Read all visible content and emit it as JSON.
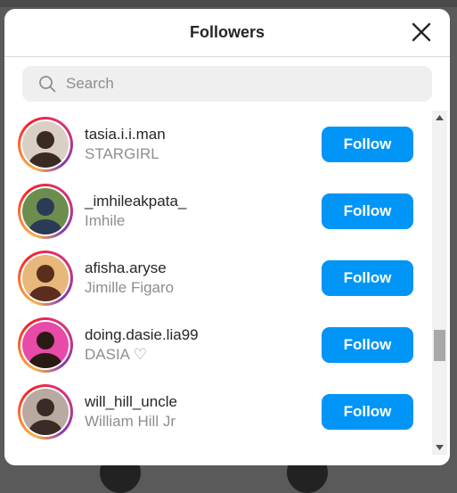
{
  "modal": {
    "title": "Followers",
    "close_icon": "close-icon"
  },
  "search": {
    "placeholder": "Search",
    "icon": "search-icon"
  },
  "followers": [
    {
      "username": "tasia.i.i.man",
      "fullname": "STARGIRL",
      "button": "Follow",
      "avatar_colors": [
        "#3a2a22",
        "#d9cfc4"
      ]
    },
    {
      "username": "_imhileakpata_",
      "fullname": "Imhile",
      "button": "Follow",
      "avatar_colors": [
        "#2b3a55",
        "#6b8e4e"
      ]
    },
    {
      "username": "afisha.aryse",
      "fullname": "Jimille Figaro",
      "button": "Follow",
      "avatar_colors": [
        "#5a2d1e",
        "#e8b87a"
      ]
    },
    {
      "username": "doing.dasie.lia99",
      "fullname": "DASIA ♡",
      "button": "Follow",
      "avatar_colors": [
        "#2a1a14",
        "#e84aa8"
      ]
    },
    {
      "username": "will_hill_uncle",
      "fullname": "William Hill Jr",
      "button": "Follow",
      "avatar_colors": [
        "#3b2b26",
        "#b9a9a0"
      ]
    }
  ],
  "colors": {
    "accent": "#0095f6",
    "overlay": "#5a5a5a"
  }
}
